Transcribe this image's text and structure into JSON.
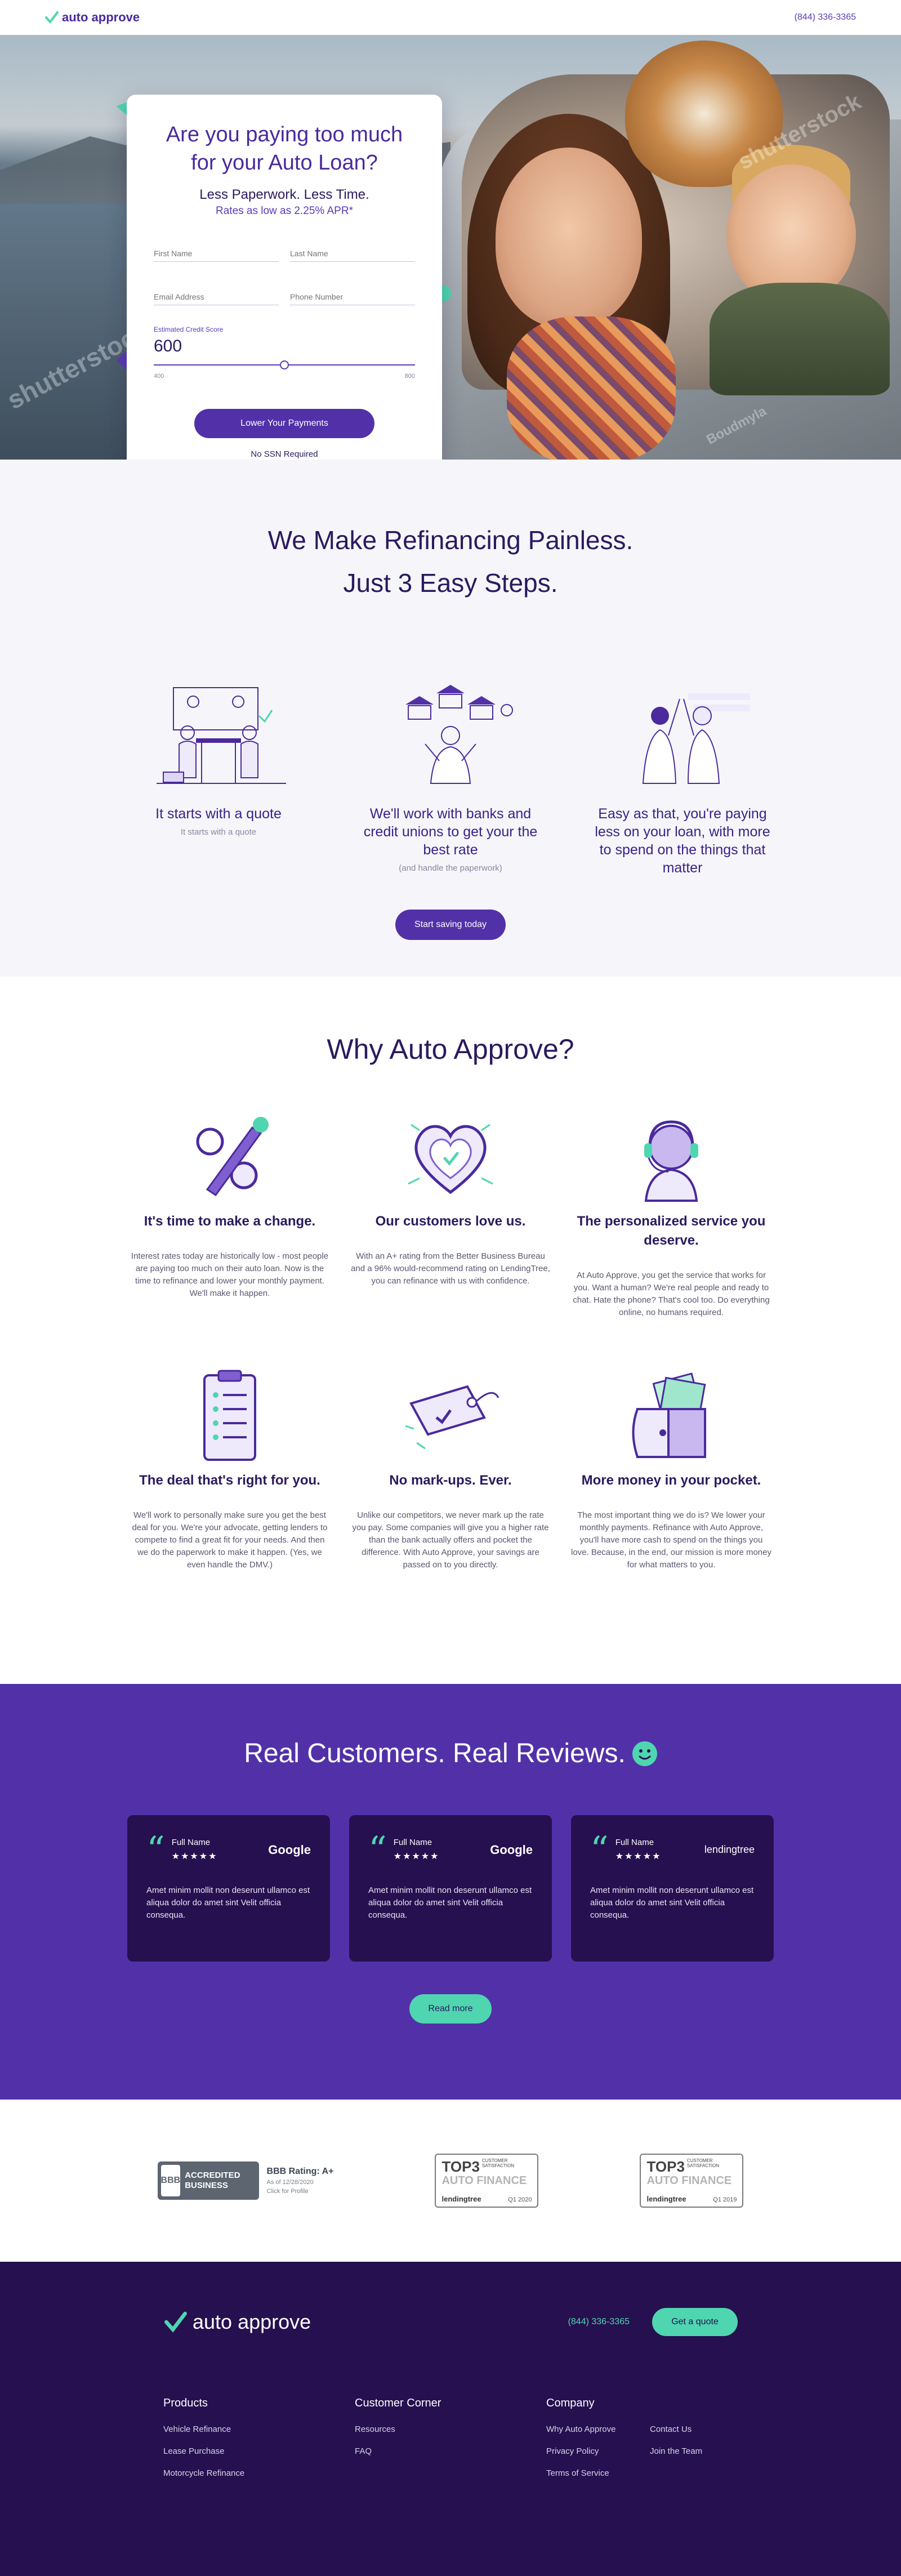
{
  "header": {
    "brand": "auto approve",
    "phone": "(844) 336-3365"
  },
  "hero": {
    "watermark": "shutterstock",
    "watermark2": "shutterstock",
    "watermark3": "Boudmyla",
    "title": "Are you paying too much for your Auto Loan?",
    "subtitle": "Less Paperwork. Less Time.",
    "rates": "Rates as low as 2.25% APR*",
    "first_name_placeholder": "First Name",
    "last_name_placeholder": "Last Name",
    "email_placeholder": "Email Address",
    "phone_placeholder": "Phone Number",
    "credit_label": "Estimated Credit Score",
    "credit_value": "600",
    "credit_fraction": 0.5,
    "slider_min": "400",
    "slider_max": "800",
    "cta": "Lower Your Payments",
    "no_ssn": "No SSN Required"
  },
  "steps": {
    "title_line1": "We Make Refinancing Painless.",
    "title_line2": "Just 3 Easy Steps.",
    "items": [
      {
        "title": "It starts with a quote",
        "sub": "It starts with a quote"
      },
      {
        "title": "We'll work with banks and credit unions to get your the best rate",
        "sub": "(and handle the paperwork)"
      },
      {
        "title": "Easy as that, you're paying less on your loan, with more to spend on the things that matter",
        "sub": ""
      }
    ],
    "button": "Start saving today"
  },
  "why": {
    "title": "Why Auto Approve?",
    "items": [
      {
        "icon": "percent-icon",
        "title": "It's time to make a change.",
        "text": "Interest rates today are historically low - most people are paying too much on their auto loan. Now is the time to refinance and lower your monthly payment. We'll make it happen."
      },
      {
        "icon": "heart-icon",
        "title": "Our customers love us.",
        "text": "With an A+ rating from the Better Business Bureau and a 96% would-recommend rating on LendingTree, you can refinance with us with confidence."
      },
      {
        "icon": "headset-agent-icon",
        "title": "The personalized service you deserve.",
        "text": "At Auto Approve, you get the service that works for you. Want a human? We're real people and ready to chat. Hate the phone? That's cool too. Do everything online, no humans required."
      },
      {
        "icon": "clipboard-checklist-icon",
        "title": "The deal that's right for you.",
        "text": "We'll work to personally make sure you get the best deal for you. We're your advocate, getting lenders to compete to find a great fit for your needs. And then we do the paperwork to make it happen. (Yes, we even handle the DMV.)"
      },
      {
        "icon": "price-tag-icon",
        "title": "No mark-ups. Ever.",
        "text": "Unlike our competitors, we never mark up the rate you pay. Some companies will give you a higher rate than the bank actually offers and pocket the difference. With Auto Approve, your savings are passed on to you directly."
      },
      {
        "icon": "wallet-cash-icon",
        "title": "More money in your pocket.",
        "text": "The most important thing we do is? We lower your monthly payments. Refinance with Auto Approve, you'll have more cash to spend on the things you love. Because, in the end, our mission is more money for what matters to you."
      }
    ]
  },
  "reviews": {
    "title": "Real Customers. Real Reviews.",
    "cards": [
      {
        "name": "Full Name",
        "stars": "★★★★★",
        "brand": "Google",
        "text": "Amet minim mollit non deserunt ullamco est aliqua dolor do amet sint Velit officia consequa."
      },
      {
        "name": "Full Name",
        "stars": "★★★★★",
        "brand": "Google",
        "text": "Amet minim mollit non deserunt ullamco est aliqua dolor do amet sint Velit officia consequa."
      },
      {
        "name": "Full Name",
        "stars": "★★★★★",
        "brand": "lendingtree",
        "text": "Amet minim mollit non deserunt ullamco est aliqua dolor do amet sint Velit officia consequa."
      }
    ],
    "button": "Read more"
  },
  "badges": {
    "bbb_logo": "BBB",
    "bbb_accredited": "ACCREDITED BUSINESS",
    "bbb_rating": "BBB Rating: A+",
    "bbb_date": "As of 12/28/2020",
    "bbb_click": "Click for Profile",
    "top3": [
      {
        "top": "TOP3",
        "cs": "CUSTOMER SATISFACTION",
        "af": "AUTO FINANCE",
        "lt": "lendingtree",
        "q": "Q1 2020"
      },
      {
        "top": "TOP3",
        "cs": "CUSTOMER SATISFACTION",
        "af": "AUTO FINANCE",
        "lt": "lendingtree",
        "q": "Q1 2019"
      }
    ]
  },
  "footer": {
    "brand": "auto approve",
    "phone": "(844) 336-3365",
    "quote_button": "Get a quote",
    "cols": [
      {
        "title": "Products",
        "links": [
          "Vehicle Refinance",
          "Lease Purchase",
          "Motorcycle Refinance"
        ]
      },
      {
        "title": "Customer Corner",
        "links": [
          "Resources",
          "FAQ"
        ]
      },
      {
        "title": "Company",
        "links": [
          "Why Auto Approve",
          "Contact Us",
          "Privacy Policy",
          "Join the Team",
          "Terms of Service"
        ]
      }
    ]
  },
  "colors": {
    "primary": "#5231a8",
    "accent": "#4fd6b0",
    "dark": "#26104f"
  }
}
